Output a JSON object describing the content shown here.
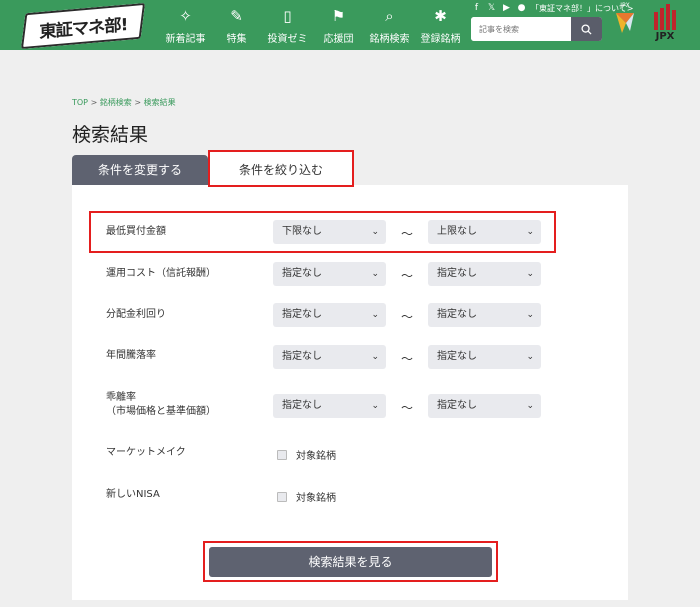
{
  "header": {
    "logo_text": "東証マネ部!",
    "nav": [
      {
        "label": "新着記事",
        "icon": "sparkle-icon"
      },
      {
        "label": "特集",
        "icon": "pen-icon"
      },
      {
        "label": "投資ゼミ",
        "icon": "book-icon"
      },
      {
        "label": "応援団",
        "icon": "flag-icon"
      },
      {
        "label": "銘柄検索",
        "icon": "etf-search-icon"
      },
      {
        "label": "登録銘柄",
        "icon": "click-icon"
      }
    ],
    "top_link": "「東証マネ部！」について>",
    "search_placeholder": "記事を検索",
    "jpx_small_text": "JPX",
    "jpx_big_text": "JPX"
  },
  "breadcrumb": {
    "top": "TOP",
    "sep": ">",
    "item2": "銘柄検索",
    "item3": "検索結果"
  },
  "page_title": "検索結果",
  "tabs": {
    "change": "条件を変更する",
    "narrow": "条件を絞り込む"
  },
  "filters": [
    {
      "label": "最低買付金額",
      "from": "下限なし",
      "to": "上限なし"
    },
    {
      "label": "運用コスト（信託報酬）",
      "from": "指定なし",
      "to": "指定なし"
    },
    {
      "label": "分配金利回り",
      "from": "指定なし",
      "to": "指定なし"
    },
    {
      "label": "年間騰落率",
      "from": "指定なし",
      "to": "指定なし"
    },
    {
      "label": "乖離率",
      "label2": "（市場価格と基準価額）",
      "from": "指定なし",
      "to": "指定なし"
    }
  ],
  "tilde": "～",
  "checks": [
    {
      "label": "マーケットメイク",
      "option": "対象銘柄"
    },
    {
      "label": "新しいNISA",
      "option": "対象銘柄"
    }
  ],
  "submit_label": "検索結果を見る",
  "colors": {
    "brand_green": "#3a9a5c",
    "highlight_red": "#e41e1e",
    "tab_gray": "#5e6270"
  }
}
